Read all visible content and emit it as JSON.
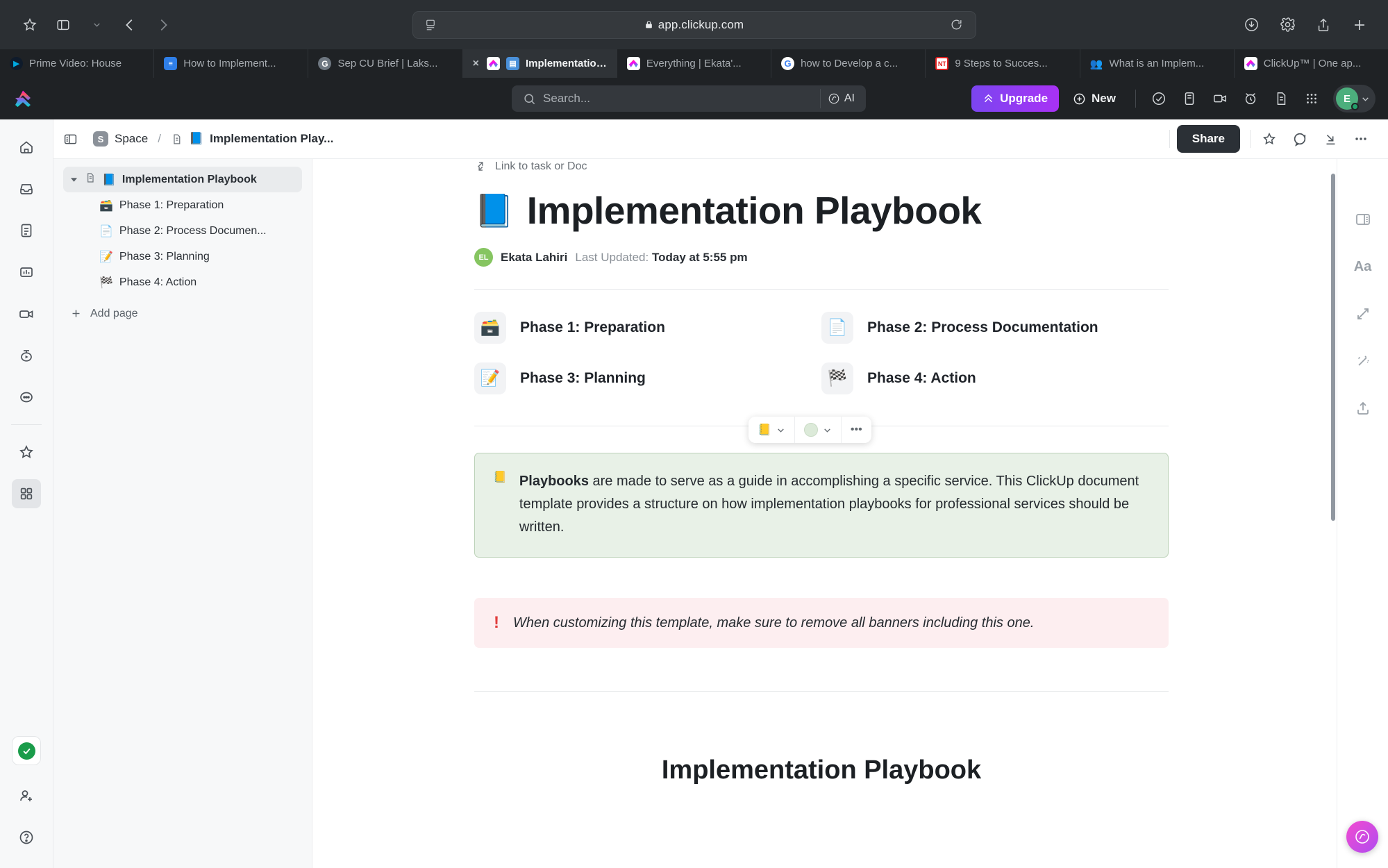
{
  "browser": {
    "url": "app.clickup.com",
    "lock_icon": "lock-icon",
    "reload_icon": "reload-icon",
    "sidebar_icon": "sidebar-toggle-icon",
    "back_icon": "back-arrow-icon",
    "forward_icon": "forward-arrow-icon",
    "bookmark_icon": "star-icon",
    "download_icon": "download-icon",
    "settings_icon": "gear-icon",
    "share_icon": "share-icon",
    "newtab_icon": "plus-icon",
    "tabs": [
      {
        "title": "Prime Video: House",
        "favicon": "prime-video-icon",
        "active": false
      },
      {
        "title": "How to Implement...",
        "favicon": "blue-doc-icon",
        "active": false
      },
      {
        "title": "Sep CU Brief | Laks...",
        "favicon": "google-docs-icon",
        "active": false
      },
      {
        "title": "Implementation...",
        "favicon": "clickup-icon",
        "active": true,
        "close": "×"
      },
      {
        "title": "Everything | Ekata'...",
        "favicon": "clickup-icon",
        "active": false
      },
      {
        "title": "how to Develop a c...",
        "favicon": "google-icon",
        "active": false
      },
      {
        "title": "9 Steps to Succes...",
        "favicon": "nt-icon",
        "active": false
      },
      {
        "title": "What is an Implem...",
        "favicon": "people-icon",
        "active": false
      },
      {
        "title": "ClickUp™ | One ap...",
        "favicon": "clickup-icon",
        "active": false
      }
    ]
  },
  "topbar": {
    "logo": "clickup-logo",
    "search_placeholder": "Search...",
    "ai_label": "AI",
    "upgrade_label": "Upgrade",
    "new_label": "New",
    "icons": [
      "check-circle-icon",
      "clipboard-icon",
      "video-camera-icon",
      "alarm-clock-icon",
      "document-icon",
      "apps-grid-icon"
    ],
    "avatar_initial": "E"
  },
  "breadcrumb": {
    "panel_toggle_icon": "panel-toggle-icon",
    "space_badge": "S",
    "space_label": "Space",
    "separator": "/",
    "doc_icon": "doc-icon",
    "doc_emoji": "📘",
    "doc_label": "Implementation Play...",
    "share_label": "Share",
    "actions": [
      "star-icon",
      "comment-icon",
      "collapse-icon",
      "more-options-icon"
    ]
  },
  "rail": {
    "items": [
      "home-icon",
      "inbox-icon",
      "docs-icon",
      "dashboards-icon",
      "clips-icon",
      "timer-icon",
      "more-icon"
    ],
    "favorites_icon": "star-icon",
    "apps_icon": "apps-grid-icon",
    "checked_icon": "green-check-icon",
    "invite_icon": "invite-person-icon",
    "help_icon": "help-question-icon"
  },
  "sidebar": {
    "title": "Implementation Playbook",
    "search_icon": "search-icon",
    "layout_icon": "split-layout-icon",
    "pages": [
      {
        "label": "Implementation Playbook",
        "emoji": "📘",
        "selected": true,
        "child": false
      },
      {
        "label": "Phase 1: Preparation",
        "emoji": "🗃️",
        "selected": false,
        "child": true
      },
      {
        "label": "Phase 2: Process Documen...",
        "emoji": "📄",
        "selected": false,
        "child": true
      },
      {
        "label": "Phase 3: Planning",
        "emoji": "📝",
        "selected": false,
        "child": true
      },
      {
        "label": "Phase 4: Action",
        "emoji": "🏁",
        "selected": false,
        "child": true
      }
    ],
    "add_page_label": "Add page",
    "add_page_icon": "plus-icon"
  },
  "doc": {
    "link_label": "Link to task or Doc",
    "link_icon": "link-arrows-icon",
    "title": "Implementation Playbook",
    "title_emoji": "📘",
    "author_initials": "EL",
    "author": "Ekata Lahiri",
    "updated_prefix": "Last Updated:",
    "updated_value": "Today at 5:55 pm",
    "phases": [
      {
        "label": "Phase 1: Preparation",
        "emoji": "🗃️"
      },
      {
        "label": "Phase 2: Process Documentation",
        "emoji": "📄"
      },
      {
        "label": "Phase 3: Planning",
        "emoji": "📝"
      },
      {
        "label": "Phase 4: Action",
        "emoji": "🏁"
      }
    ],
    "float_toolbar": {
      "emoji": "📒",
      "chevron": "chevron-down-icon",
      "color_swatch": "#dcead9",
      "more": "•••"
    },
    "callout_green": {
      "emoji": "📒",
      "bold_lead": "Playbooks",
      "text": " are made to serve as a guide in accomplishing a specific service. This ClickUp document template provides a structure on how implementation playbooks for professional services should be written.",
      "bg": "#e8f1e7",
      "border": "#bcd2b8"
    },
    "callout_red": {
      "icon": "!",
      "text": "When customizing this template, make sure to remove all banners including this one.",
      "bg": "#fdeef0",
      "icon_color": "#e03c3c"
    },
    "bottom_heading": "Implementation Playbook"
  },
  "right_rail": {
    "items": [
      "page-layout-icon",
      "font-size-icon",
      "expand-collapse-icon",
      "magic-wand-icon",
      "export-icon"
    ],
    "font_label": "Aa",
    "ai_fab_icon": "clickup-ai-icon"
  },
  "colors": {
    "chrome_bg": "#2b2f33",
    "tab_bg": "#1f2225",
    "accent_purple": "#a832f5",
    "share_dark": "#2b3036",
    "green": "#1a9c4a"
  }
}
